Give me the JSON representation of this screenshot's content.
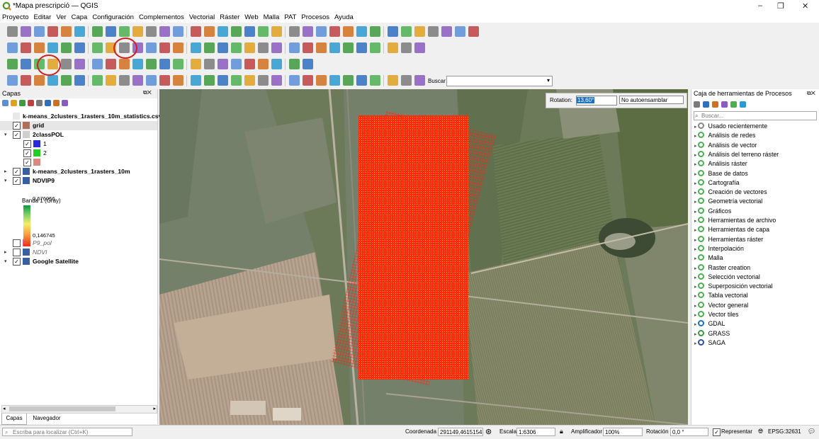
{
  "window": {
    "title": "*Mapa prescripció — QGIS",
    "minimize": "–",
    "maximize": "❐",
    "close": "✕"
  },
  "menu": [
    "Proyecto",
    "Editar",
    "Ver",
    "Capa",
    "Configuración",
    "Complementos",
    "Vectorial",
    "Ráster",
    "Web",
    "Malla",
    "PAT",
    "Procesos",
    "Ayuda"
  ],
  "toolbar": {
    "search_label": "Buscar",
    "search_value": ""
  },
  "layers_panel": {
    "title": "Capas",
    "items": [
      {
        "name": "k-means_2clusters_1rasters_10m_statistics.csv",
        "checked": false,
        "bold": true
      },
      {
        "name": "grid",
        "checked": true,
        "bold": true
      },
      {
        "name": "2classPOL",
        "checked": true,
        "bold": true
      },
      {
        "name": "1",
        "checked": true,
        "color": "#2b2bd6"
      },
      {
        "name": "2",
        "checked": true,
        "color": "#22d022"
      },
      {
        "name": "",
        "checked": true,
        "color": "#d88a80"
      },
      {
        "name": "k-means_2clusters_1rasters_10m",
        "checked": true,
        "bold": true
      },
      {
        "name": "NDVIP9",
        "checked": true,
        "bold": true
      },
      {
        "name": "P9_pol",
        "checked": false,
        "italic": true
      },
      {
        "name": "NDVI",
        "checked": false,
        "italic": true
      },
      {
        "name": "Google Satellite",
        "checked": true,
        "bold": true
      }
    ],
    "band_label": "Banda 1 (Gray)",
    "ramp_max": "0,676056",
    "ramp_min": "0,146745",
    "tabs": [
      "Capas",
      "Navegador"
    ]
  },
  "map": {
    "rotation_label": "Rotation:",
    "rotation_value": "13,60°",
    "snap_value": "No autoensamblar"
  },
  "toolbox": {
    "title": "Caja de herramientas de Procesos",
    "search_placeholder": "Buscar...",
    "items": [
      "Usado recientemente",
      "Análisis de redes",
      "Análisis de vector",
      "Análisis del terreno ráster",
      "Análisis ráster",
      "Base de datos",
      "Cartografía",
      "Creación de vectores",
      "Geometría vectorial",
      "Gráficos",
      "Herramientas de archivo",
      "Herramientas de capa",
      "Herramientas ráster",
      "Interpolación",
      "Malla",
      "Raster creation",
      "Selección vectorial",
      "Superposición vectorial",
      "Tabla vectorial",
      "Vector general",
      "Vector tiles",
      "GDAL",
      "GRASS",
      "SAGA"
    ]
  },
  "statusbar": {
    "locate_placeholder": "Escriba para localizar (Ctrl+K)",
    "coord_label": "Coordenada",
    "coord_value": "291149,4615154",
    "scale_label": "Escala",
    "scale_value": "1:6306",
    "magnifier_label": "Amplificador",
    "magnifier_value": "100%",
    "rotation_label": "Rotación",
    "rotation_value": "0,0 °",
    "render_label": "Representar",
    "crs": "EPSG:32631"
  },
  "colors": {
    "accent": "#1f6fbf",
    "grid": "#ff2a10",
    "qgis_green": "#4caf50"
  }
}
